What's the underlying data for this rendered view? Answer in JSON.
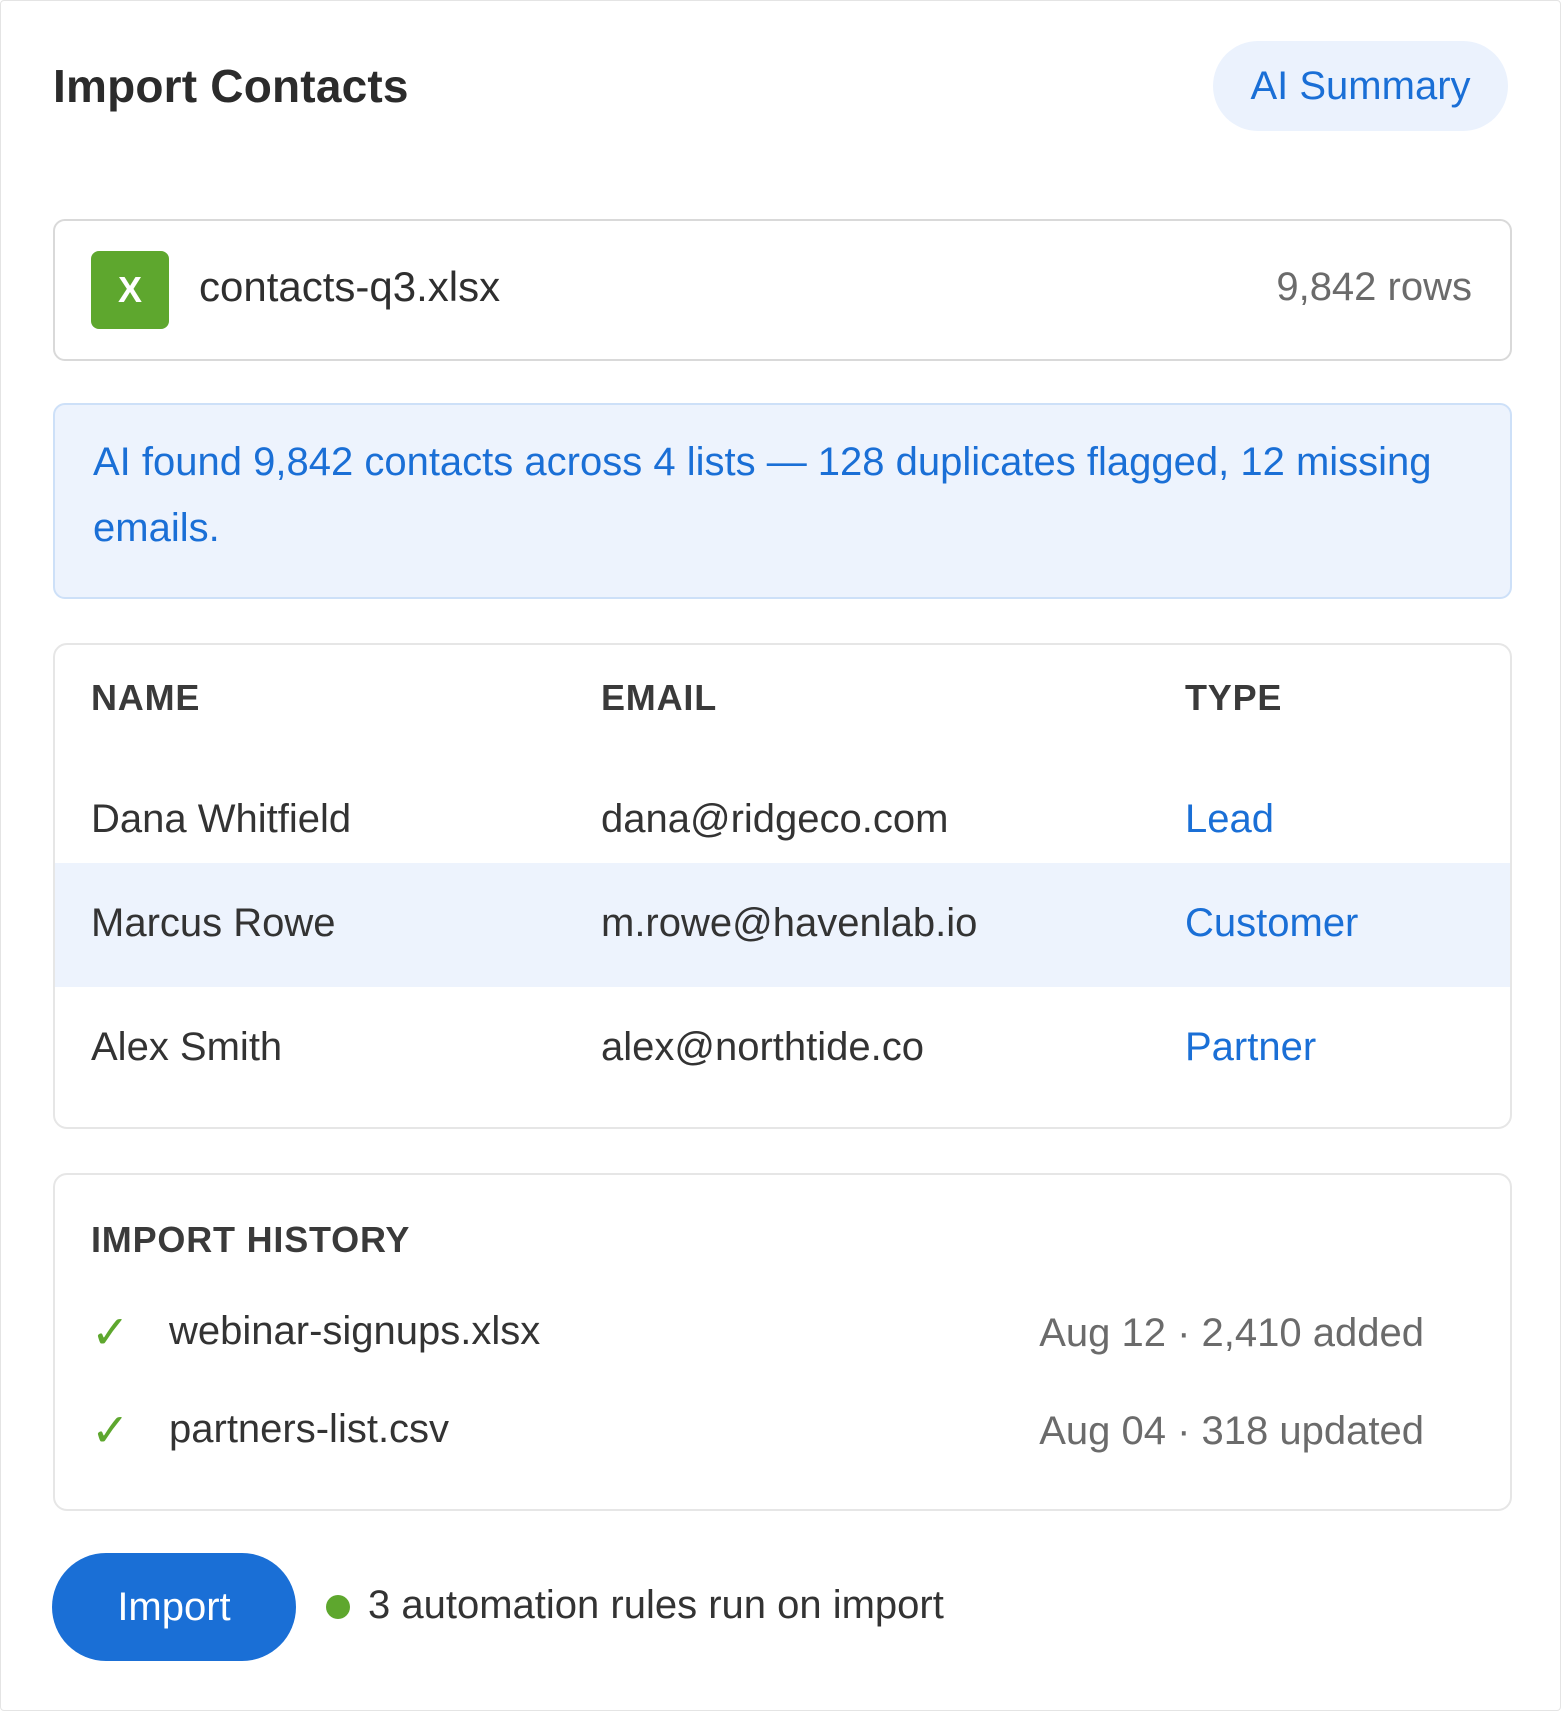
{
  "header": {
    "title": "Import Contacts",
    "ai_summary_label": "AI Summary"
  },
  "file": {
    "icon_letter": "X",
    "name": "contacts-q3.xlsx",
    "rows": "9,842 rows"
  },
  "ai_banner": {
    "text": "AI found 9,842 contacts across 4 lists — 128 duplicates flagged, 12 missing emails."
  },
  "table": {
    "columns": [
      "NAME",
      "EMAIL",
      "TYPE"
    ],
    "rows": [
      {
        "name": "Dana Whitfield",
        "email": "dana@ridgeco.com",
        "type": "Lead"
      },
      {
        "name": "Marcus Rowe",
        "email": "m.rowe@havenlab.io",
        "type": "Customer"
      },
      {
        "name": "Alex Smith",
        "email": "alex@northtide.co",
        "type": "Partner"
      }
    ]
  },
  "history": {
    "title": "IMPORT HISTORY",
    "items": [
      {
        "icon": "check-icon",
        "name": "webinar-signups.xlsx",
        "meta": "Aug 12 · 2,410 added"
      },
      {
        "icon": "check-icon",
        "name": "partners-list.csv",
        "meta": "Aug 04 · 318 updated"
      }
    ]
  },
  "footer": {
    "import_label": "Import",
    "rules_text": "3 automation rules run on import"
  },
  "colors": {
    "accent": "#1a6fd6",
    "success": "#5ea72e",
    "highlight": "#edf3fd"
  }
}
